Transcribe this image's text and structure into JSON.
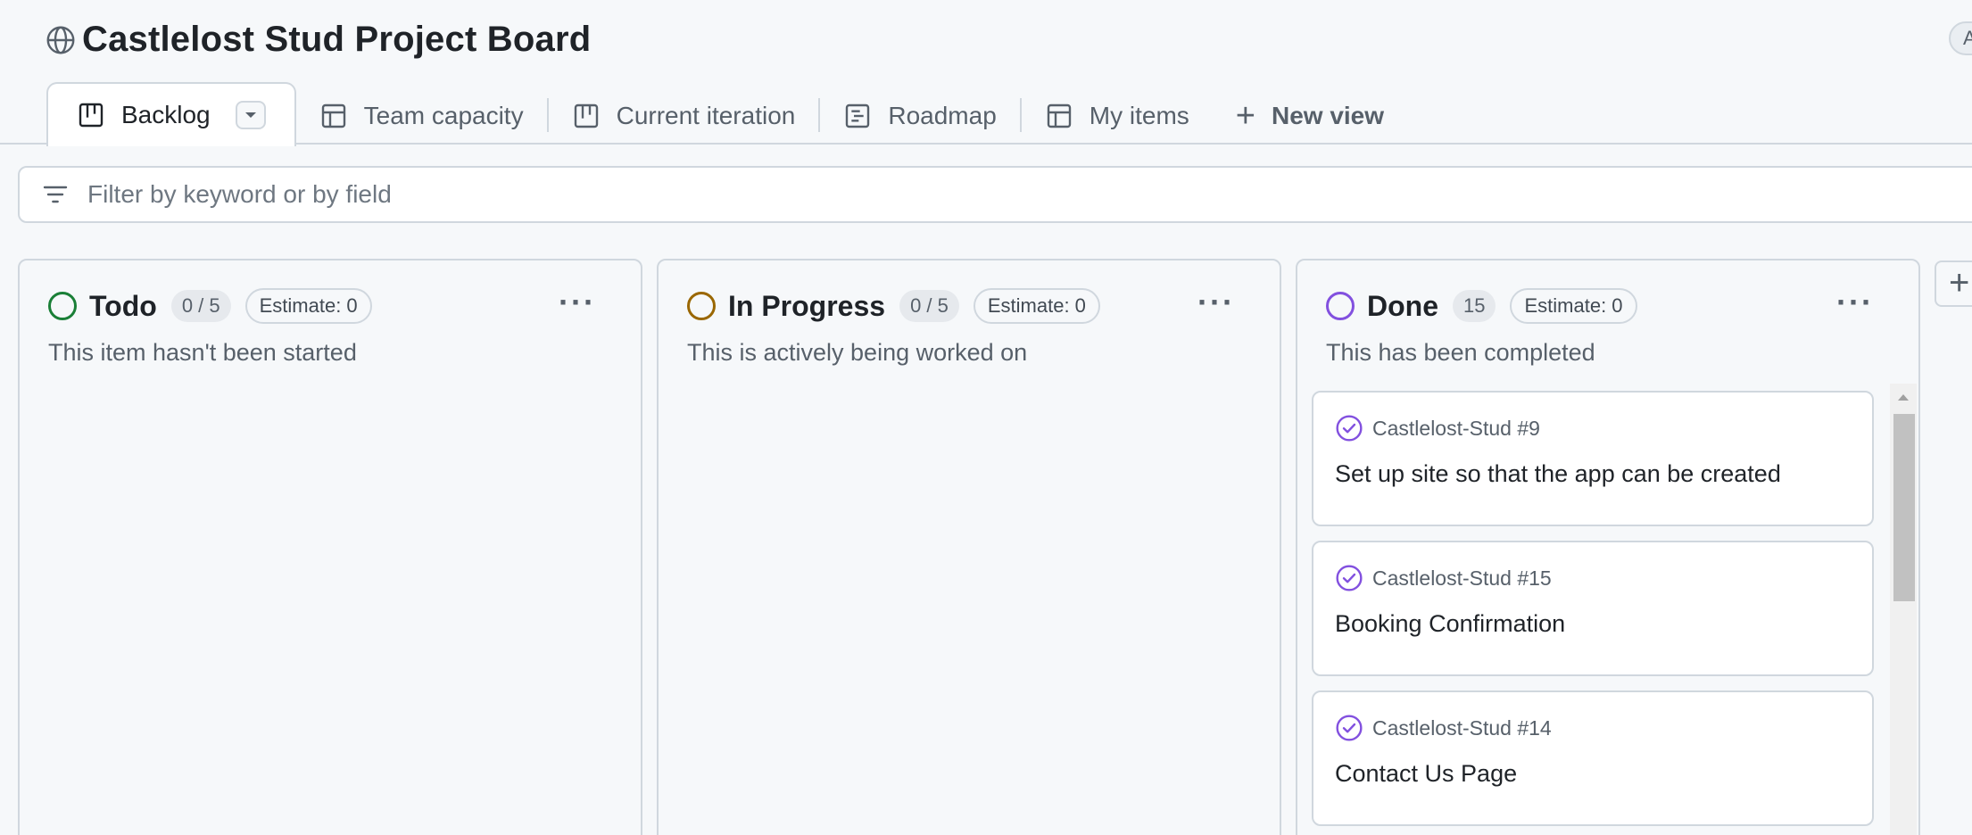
{
  "project": {
    "title": "Castlelost Stud Project Board",
    "top_right_label": "A"
  },
  "tabs": [
    {
      "label": "Backlog",
      "icon": "board-icon",
      "active": true
    },
    {
      "label": "Team capacity",
      "icon": "table-icon"
    },
    {
      "label": "Current iteration",
      "icon": "board-icon"
    },
    {
      "label": "Roadmap",
      "icon": "roadmap-icon"
    },
    {
      "label": "My items",
      "icon": "table-icon"
    }
  ],
  "new_view": {
    "label": "New view",
    "icon": "plus-icon"
  },
  "filter": {
    "placeholder": "Filter by keyword or by field",
    "icon": "filter-icon"
  },
  "columns": [
    {
      "title": "Todo",
      "count": "0 / 5",
      "estimate": "Estimate: 0",
      "description": "This item hasn't been started",
      "color": "#1a7f37"
    },
    {
      "title": "In Progress",
      "count": "0 / 5",
      "estimate": "Estimate: 0",
      "description": "This is actively being worked on",
      "color": "#9a6700"
    },
    {
      "title": "Done",
      "count": "15",
      "estimate": "Estimate: 0",
      "description": "This has been completed",
      "color": "#8250df",
      "cards": [
        {
          "ref": "Castlelost-Stud #9",
          "title": "Set up site so that the app can be created"
        },
        {
          "ref": "Castlelost-Stud #15",
          "title": "Booking Confirmation"
        },
        {
          "ref": "Castlelost-Stud #14",
          "title": "Contact Us Page"
        }
      ]
    }
  ],
  "colors": {
    "done_icon": "#8250df",
    "border": "#d0d7de",
    "background": "#f6f8fa"
  },
  "more_label": "···",
  "add_column_label": "+"
}
